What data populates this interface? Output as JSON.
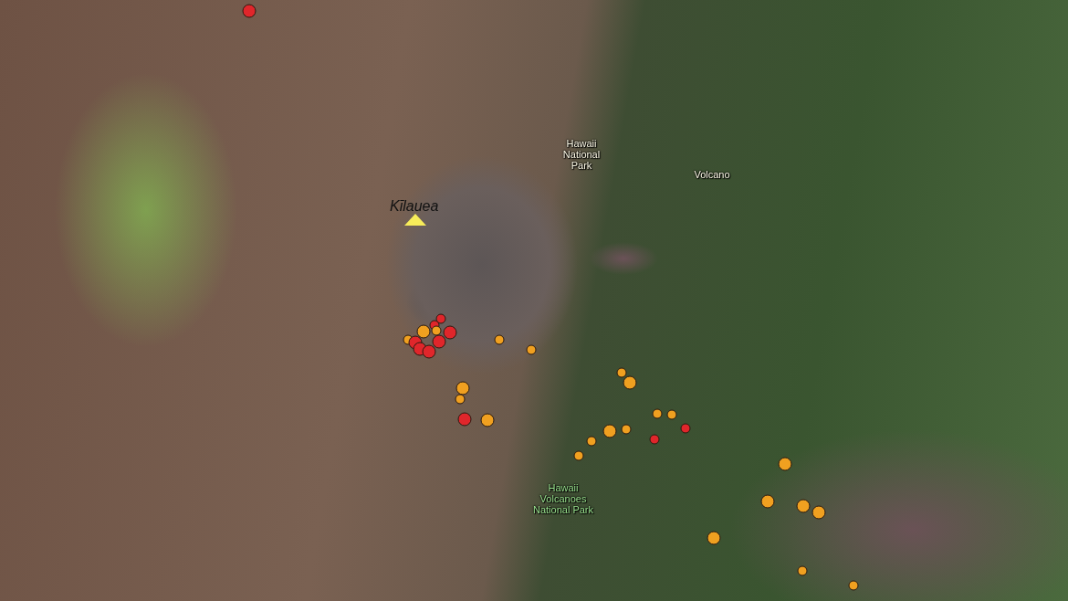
{
  "volcano": {
    "name": "Kīlauea"
  },
  "place_labels": [
    {
      "text": "Hawaii\nNational\nPark",
      "kind": "town"
    },
    {
      "text": "Volcano",
      "kind": "town"
    },
    {
      "text": "Hawaii\nVolcanoes\nNational Park",
      "kind": "park"
    }
  ],
  "earthquakes": [
    {
      "color": "#e0262b",
      "kind": "large"
    },
    {
      "color": "#e0262b",
      "kind": "small"
    },
    {
      "color": "#e0262b",
      "kind": "small"
    },
    {
      "color": "#f0a020",
      "kind": "small"
    },
    {
      "color": "#f0a020",
      "kind": "large"
    },
    {
      "color": "#f0a020",
      "kind": "small"
    },
    {
      "color": "#e0262b",
      "kind": "large"
    },
    {
      "color": "#e0262b",
      "kind": "large"
    },
    {
      "color": "#e0262b",
      "kind": "large"
    },
    {
      "color": "#e0262b",
      "kind": "large"
    },
    {
      "color": "#e0262b",
      "kind": "large"
    },
    {
      "color": "#f0a020",
      "kind": "small"
    },
    {
      "color": "#f0a020",
      "kind": "small"
    },
    {
      "color": "#f0a020",
      "kind": "large"
    },
    {
      "color": "#f0a020",
      "kind": "small"
    },
    {
      "color": "#e0262b",
      "kind": "large"
    },
    {
      "color": "#f0a020",
      "kind": "large"
    },
    {
      "color": "#f0a020",
      "kind": "small"
    },
    {
      "color": "#f0a020",
      "kind": "large"
    },
    {
      "color": "#f0a020",
      "kind": "small"
    },
    {
      "color": "#f0a020",
      "kind": "small"
    },
    {
      "color": "#e0262b",
      "kind": "small"
    },
    {
      "color": "#f0a020",
      "kind": "large"
    },
    {
      "color": "#f0a020",
      "kind": "small"
    },
    {
      "color": "#e0262b",
      "kind": "small"
    },
    {
      "color": "#f0a020",
      "kind": "small"
    },
    {
      "color": "#f0a020",
      "kind": "small"
    },
    {
      "color": "#f0a020",
      "kind": "large"
    },
    {
      "color": "#f0a020",
      "kind": "large"
    },
    {
      "color": "#f0a020",
      "kind": "large"
    },
    {
      "color": "#f0a020",
      "kind": "large"
    },
    {
      "color": "#f0a020",
      "kind": "large"
    },
    {
      "color": "#f0a020",
      "kind": "small"
    },
    {
      "color": "#f0a020",
      "kind": "small"
    }
  ]
}
